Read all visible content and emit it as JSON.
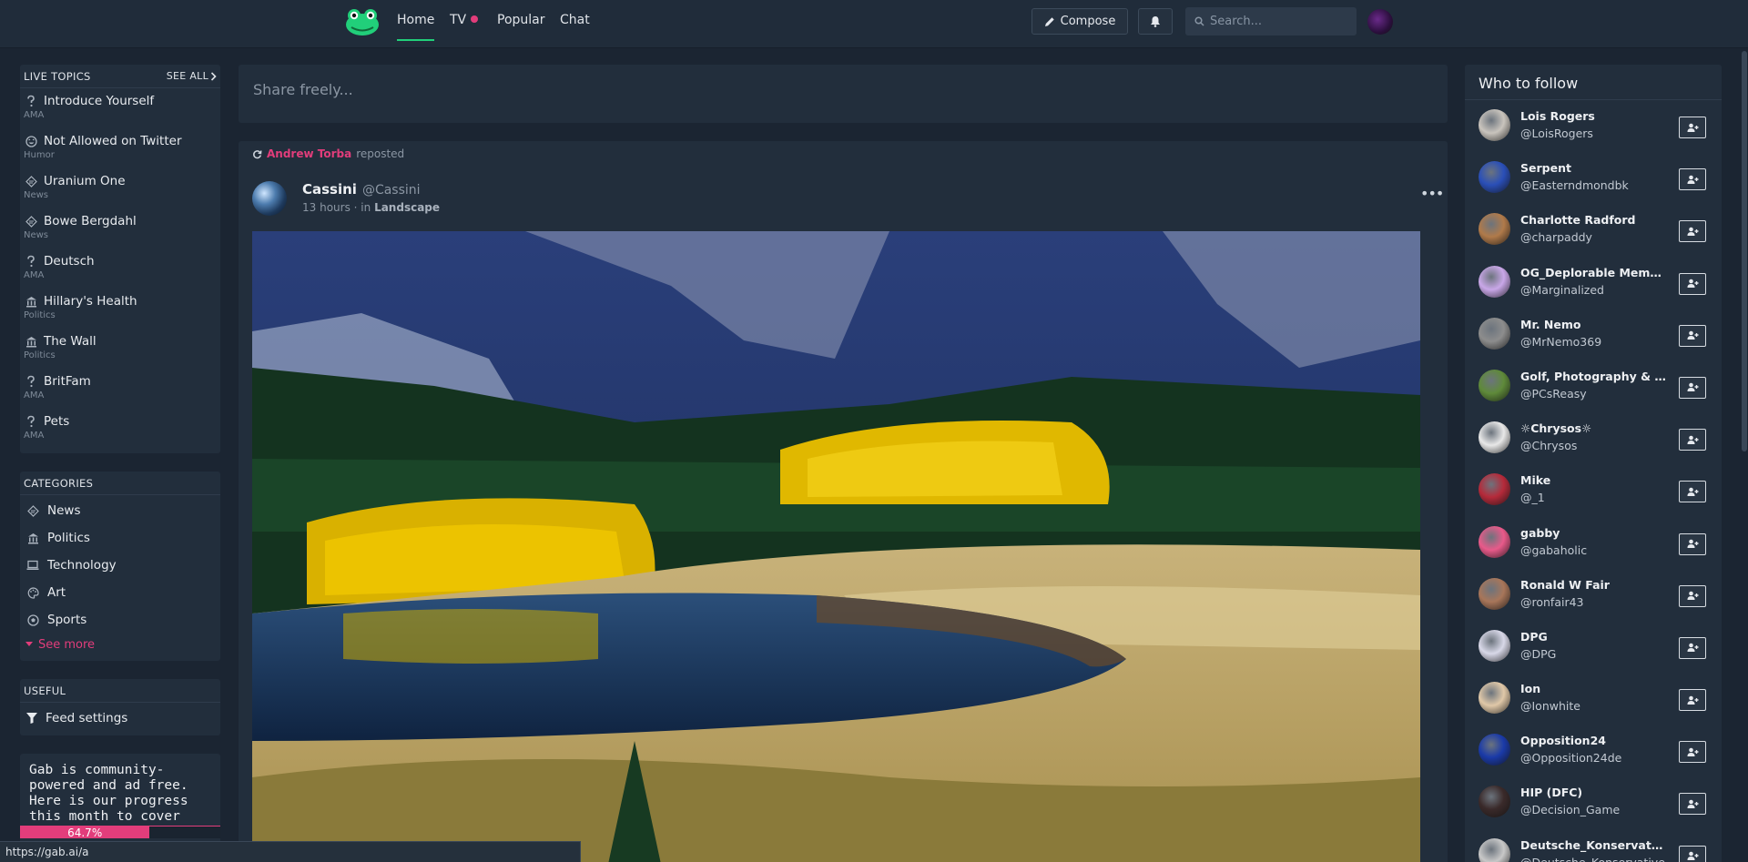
{
  "nav": {
    "items": [
      {
        "label": "Home",
        "active": true
      },
      {
        "label": "TV",
        "active": false,
        "has_dot": true
      },
      {
        "label": "Popular",
        "active": false
      },
      {
        "label": "Chat",
        "active": false
      }
    ],
    "compose_label": "Compose",
    "search_placeholder": "Search..."
  },
  "live_topics": {
    "header": "LIVE TOPICS",
    "see_all": "SEE ALL",
    "items": [
      {
        "title": "Introduce Yourself",
        "category": "AMA",
        "icon": "question-icon"
      },
      {
        "title": "Not Allowed on Twitter",
        "category": "Humor",
        "icon": "laugh-icon"
      },
      {
        "title": "Uranium One",
        "category": "News",
        "icon": "news-icon"
      },
      {
        "title": "Bowe Bergdahl",
        "category": "News",
        "icon": "news-icon"
      },
      {
        "title": "Deutsch",
        "category": "AMA",
        "icon": "question-icon"
      },
      {
        "title": "Hillary's Health",
        "category": "Politics",
        "icon": "capitol-icon"
      },
      {
        "title": "The Wall",
        "category": "Politics",
        "icon": "capitol-icon"
      },
      {
        "title": "BritFam",
        "category": "AMA",
        "icon": "question-icon"
      },
      {
        "title": "Pets",
        "category": "AMA",
        "icon": "question-icon"
      }
    ]
  },
  "categories": {
    "header": "CATEGORIES",
    "items": [
      {
        "label": "News",
        "icon": "news-icon"
      },
      {
        "label": "Politics",
        "icon": "capitol-icon"
      },
      {
        "label": "Technology",
        "icon": "laptop-icon"
      },
      {
        "label": "Art",
        "icon": "palette-icon"
      },
      {
        "label": "Sports",
        "icon": "ball-icon"
      }
    ],
    "see_more": "See more"
  },
  "useful": {
    "header": "USEFUL",
    "feed_settings": "Feed settings"
  },
  "funding": {
    "text": "Gab is community-powered and ad free. Here is our progress this month to cover costs:",
    "progress_label": "64.7%",
    "progress_fraction": 0.647
  },
  "composer": {
    "placeholder": "Share freely..."
  },
  "post": {
    "reposter": "Andrew Torba",
    "repost_text": "reposted",
    "author_name": "Cassini",
    "author_handle": "@Cassini",
    "time": "13 hours",
    "in_text": "· in",
    "group": "Landscape",
    "menu_glyph": "•••"
  },
  "who_to_follow": {
    "title": "Who to follow",
    "users": [
      {
        "name": "Lois Rogers",
        "handle": "@LoisRogers",
        "color": "#c9c4bd"
      },
      {
        "name": "Serpent",
        "handle": "@Easterndmondbk",
        "color": "#2a4fb8"
      },
      {
        "name": "Charlotte Radford",
        "handle": "@charpaddy",
        "color": "#b07a4a"
      },
      {
        "name": "OG_Deplorable Membe...",
        "handle": "@Marginalized",
        "color": "#c9a7e8"
      },
      {
        "name": "Mr. Nemo",
        "handle": "@MrNemo369",
        "color": "#8d8d8d"
      },
      {
        "name": "Golf, Photography & PCs",
        "handle": "@PCsReasy",
        "color": "#5f8a3a"
      },
      {
        "name": "☼Chrysos☼",
        "handle": "@Chrysos",
        "color": "#e8e8e8"
      },
      {
        "name": "Mike",
        "handle": "@_1",
        "color": "#b52a3a"
      },
      {
        "name": "gabby",
        "handle": "@gabaholic",
        "color": "#e85a8a"
      },
      {
        "name": "Ronald W Fair",
        "handle": "@ronfair43",
        "color": "#a8765a"
      },
      {
        "name": "DPG",
        "handle": "@DPG",
        "color": "#d8d8e8"
      },
      {
        "name": "Ion",
        "handle": "@Ionwhite",
        "color": "#e0c8a8"
      },
      {
        "name": "Opposition24",
        "handle": "@Opposition24de",
        "color": "#1a3aa8"
      },
      {
        "name": "HIP (DFC)",
        "handle": "@Decision_Game",
        "color": "#3a2a2a"
      },
      {
        "name": "Deutsche_Konservative...",
        "handle": "@Deutsche_Konservative",
        "color": "#c8c8c8"
      }
    ]
  },
  "status_bar": {
    "url": "https://gab.ai/a"
  }
}
